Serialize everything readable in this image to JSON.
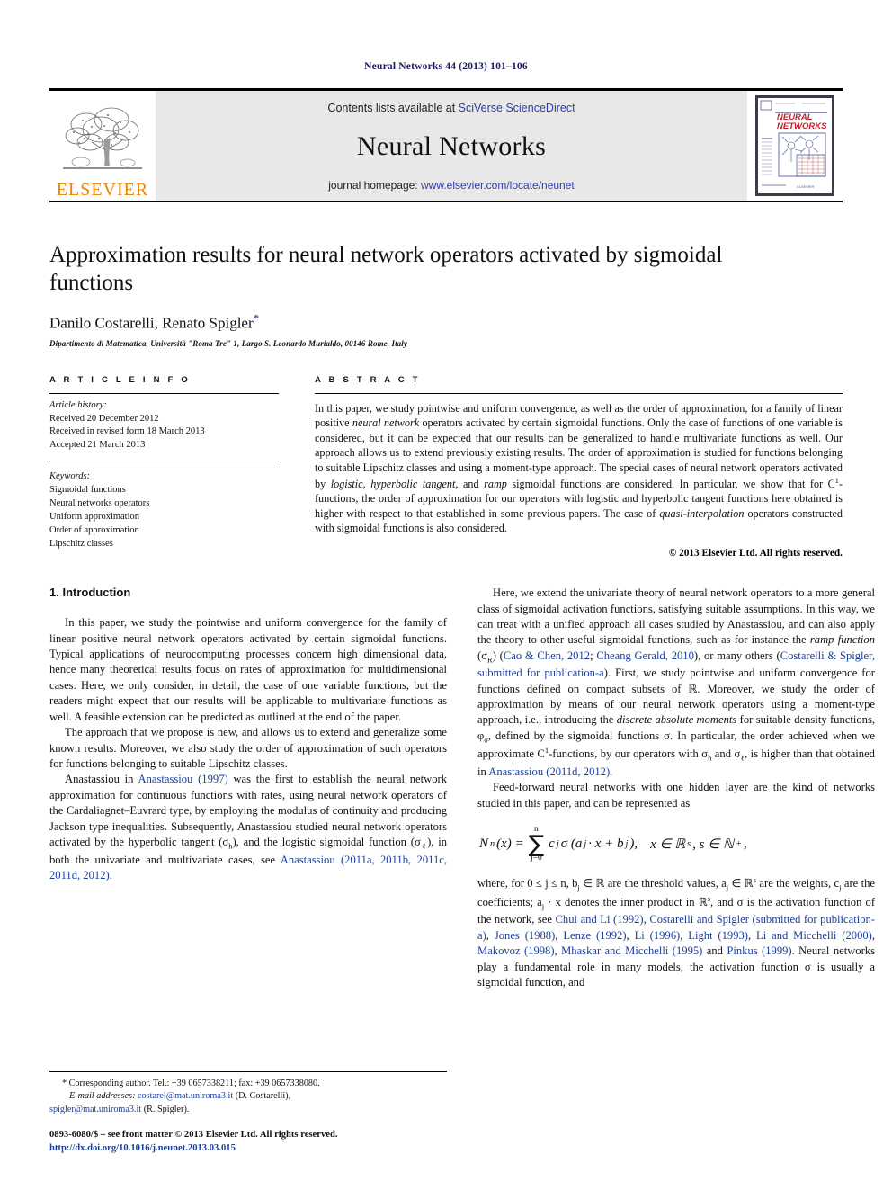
{
  "running_head": "Neural Networks 44 (2013) 101–106",
  "masthead": {
    "contents_prefix": "Contents lists available at ",
    "contents_link": "SciVerse ScienceDirect",
    "journal_title": "Neural Networks",
    "homepage_prefix": "journal homepage: ",
    "homepage_link": "www.elsevier.com/locate/neunet",
    "publisher_wordmark": "ELSEVIER",
    "cover_title_line1": "NEURAL",
    "cover_title_line2": "NETWORKS",
    "accent_link_color": "#2f3fa8",
    "publisher_orange": "#ef8200",
    "cover_red": "#c3202e"
  },
  "title": "Approximation results for neural network operators activated by sigmoidal functions",
  "authors": "Danilo Costarelli, Renato Spigler",
  "author_marker": "*",
  "affiliation": "Dipartimento di Matematica, Università \"Roma Tre\" 1, Largo S. Leonardo Murialdo, 00146 Rome, Italy",
  "article_info": {
    "heading": "A R T I C L E   I N F O",
    "history_label": "Article history:",
    "history": [
      "Received 20 December 2012",
      "Received in revised form 18 March 2013",
      "Accepted 21 March 2013"
    ],
    "keywords_label": "Keywords:",
    "keywords": [
      "Sigmoidal functions",
      "Neural networks operators",
      "Uniform approximation",
      "Order of approximation",
      "Lipschitz classes"
    ]
  },
  "abstract": {
    "heading": "A B S T R A C T",
    "p1_a": "In this paper, we study pointwise and uniform convergence, as well as the order of approximation, for a family of linear positive ",
    "p1_i1": "neural network",
    "p1_b": " operators activated by certain sigmoidal functions. Only the case of functions of one variable is considered, but it can be expected that our results can be generalized to handle multivariate functions as well. Our approach allows us to extend previously existing results. The order of approximation is studied for functions belonging to suitable Lipschitz classes and using a moment-type approach. The special cases of neural network operators activated by ",
    "p1_i2": "logistic",
    "p1_c": ", ",
    "p1_i3": "hyperbolic tangent",
    "p1_d": ", and ",
    "p1_i4": "ramp",
    "p1_e": " sigmoidal functions are considered. In particular, we show that for C",
    "p1_sup": "1",
    "p1_f": "-functions, the order of approximation for our operators with logistic and hyperbolic tangent functions here obtained is higher with respect to that established in some previous papers. The case of ",
    "p1_i5": "quasi-interpolation",
    "p1_g": " operators constructed with sigmoidal functions is also considered.",
    "copyright": "© 2013 Elsevier Ltd. All rights reserved."
  },
  "body": {
    "section_title": "1. Introduction",
    "left": {
      "p1": "In this paper, we study the pointwise and uniform convergence for the family of linear positive neural network operators activated by certain sigmoidal functions. Typical applications of neurocomputing processes concern high dimensional data, hence many theoretical results focus on rates of approximation for multidimensional cases. Here, we only consider, in detail, the case of one variable functions, but the readers might expect that our results will be applicable to multivariate functions as well. A feasible extension can be predicted as outlined at the end of the paper.",
      "p2": "The approach that we propose is new, and allows us to extend and generalize some known results. Moreover, we also study the order of approximation of such operators for functions belonging to suitable Lipschitz classes.",
      "p3_a": "Anastassiou in ",
      "p3_cite1": "Anastassiou (1997)",
      "p3_b": " was the first to establish the neural network approximation for continuous functions with rates, using neural network operators of the Cardaliagnet–Euvrard type, by employing the modulus of continuity and producing Jackson type inequalities. Subsequently, Anastassiou studied neural network operators activated by the hyperbolic tangent (σ",
      "p3_sub1": "h",
      "p3_c": "), and the logistic sigmoidal function (σ",
      "p3_sub2": "ℓ",
      "p3_d": "), in both the univariate and multivariate cases, see ",
      "p3_cite2": "Anastassiou (2011a, 2011b, 2011c, 2011d, 2012)",
      "p3_e": "."
    },
    "right": {
      "p1_a": "Here, we extend the univariate theory of neural network operators to a more general class of sigmoidal activation functions, satisfying suitable assumptions. In this way, we can treat with a unified approach all cases studied by Anastassiou, and can also apply the theory to other useful sigmoidal functions, such as for instance the ",
      "p1_i1": "ramp function",
      "p1_b": " (σ",
      "p1_sub1": "R",
      "p1_c": ") (",
      "p1_cite1": "Cao & Chen, 2012",
      "p1_d": "; ",
      "p1_cite2": "Cheang Gerald, 2010",
      "p1_e": "), or many others (",
      "p1_cite3": "Costarelli & Spigler, submitted for publication-a",
      "p1_f": "). First, we study pointwise and uniform convergence for functions defined on compact subsets of ℝ. Moreover, we study the order of approximation by means of our neural network operators using a moment-type approach, i.e., introducing the ",
      "p1_i2": "discrete absolute moments",
      "p1_g": " for suitable density functions, φ",
      "p1_sub2": "σ",
      "p1_h": ", defined by the sigmoidal functions σ. In particular, the order achieved when we approximate C",
      "p1_sup1": "1",
      "p1_i": "-functions, by our operators with σ",
      "p1_sub3": "h",
      "p1_j": " and σ",
      "p1_sub4": "ℓ",
      "p1_k": ", is higher than that obtained in ",
      "p1_cite4": "Anastassiou (2011d, 2012)",
      "p1_l": ".",
      "p2": "Feed-forward neural networks with one hidden layer are the kind of networks studied in this paper, and can be represented as",
      "equation": {
        "lhs": "N",
        "lhs_sub": "n",
        "lhs_arg": "(x) =",
        "sum_upper": "n",
        "sum_lower": "j=0",
        "rhs": "c",
        "rhs_sub": "j",
        "rhs2": "σ (a",
        "rhs2_sub": "j",
        "rhs3": " · x + b",
        "rhs3_sub": "j",
        "rhs4": "),",
        "domain": "x ∈ ℝ",
        "domain_sup": "s",
        "domain2": ", s ∈ ℕ",
        "domain2_sup": "+",
        "tail": ","
      },
      "p3_a": "where, for 0 ≤ j ≤ n, b",
      "p3_sub1": "j",
      "p3_b": " ∈ ℝ are the threshold values, a",
      "p3_sub2": "j",
      "p3_c": " ∈ ℝ",
      "p3_sup1": "s",
      "p3_d": " are the weights, c",
      "p3_sub3": "j",
      "p3_e": " are the coefficients; a",
      "p3_sub4": "j",
      "p3_f": " · x denotes the inner product in ℝ",
      "p3_sup2": "s",
      "p3_g": ", and σ is the activation function of the network, see ",
      "p3_cite1": "Chui and Li (1992)",
      "p3_h": ", ",
      "p3_cite2": "Costarelli and Spigler (submitted for publication-a)",
      "p3_i": ", ",
      "p3_cite3": "Jones (1988)",
      "p3_j": ", ",
      "p3_cite4": "Lenze (1992)",
      "p3_k": ", ",
      "p3_cite5": "Li (1996)",
      "p3_l": ", ",
      "p3_cite6": "Light (1993)",
      "p3_m": ", ",
      "p3_cite7": "Li and Micchelli (2000)",
      "p3_n": ", ",
      "p3_cite8": "Makovoz (1998)",
      "p3_o": ", ",
      "p3_cite9": "Mhaskar and Micchelli (1995)",
      "p3_p": " and ",
      "p3_cite10": "Pinkus (1999)",
      "p3_q": ". Neural networks play a fundamental role in many models, the activation function σ is usually a sigmoidal function, and"
    }
  },
  "footnote": {
    "marker": "*",
    "corresponding": " Corresponding author. Tel.: +39 0657338211; fax: +39 0657338080.",
    "email_label": "E-mail addresses:",
    "email1": "costarel@mat.uniroma3.it",
    "email1_who": " (D. Costarelli),",
    "email2": "spigler@mat.uniroma3.it",
    "email2_who": " (R. Spigler).",
    "frontmatter": "0893-6080/$ – see front matter © 2013 Elsevier Ltd. All rights reserved.",
    "doi": "http://dx.doi.org/10.1016/j.neunet.2013.03.015"
  }
}
